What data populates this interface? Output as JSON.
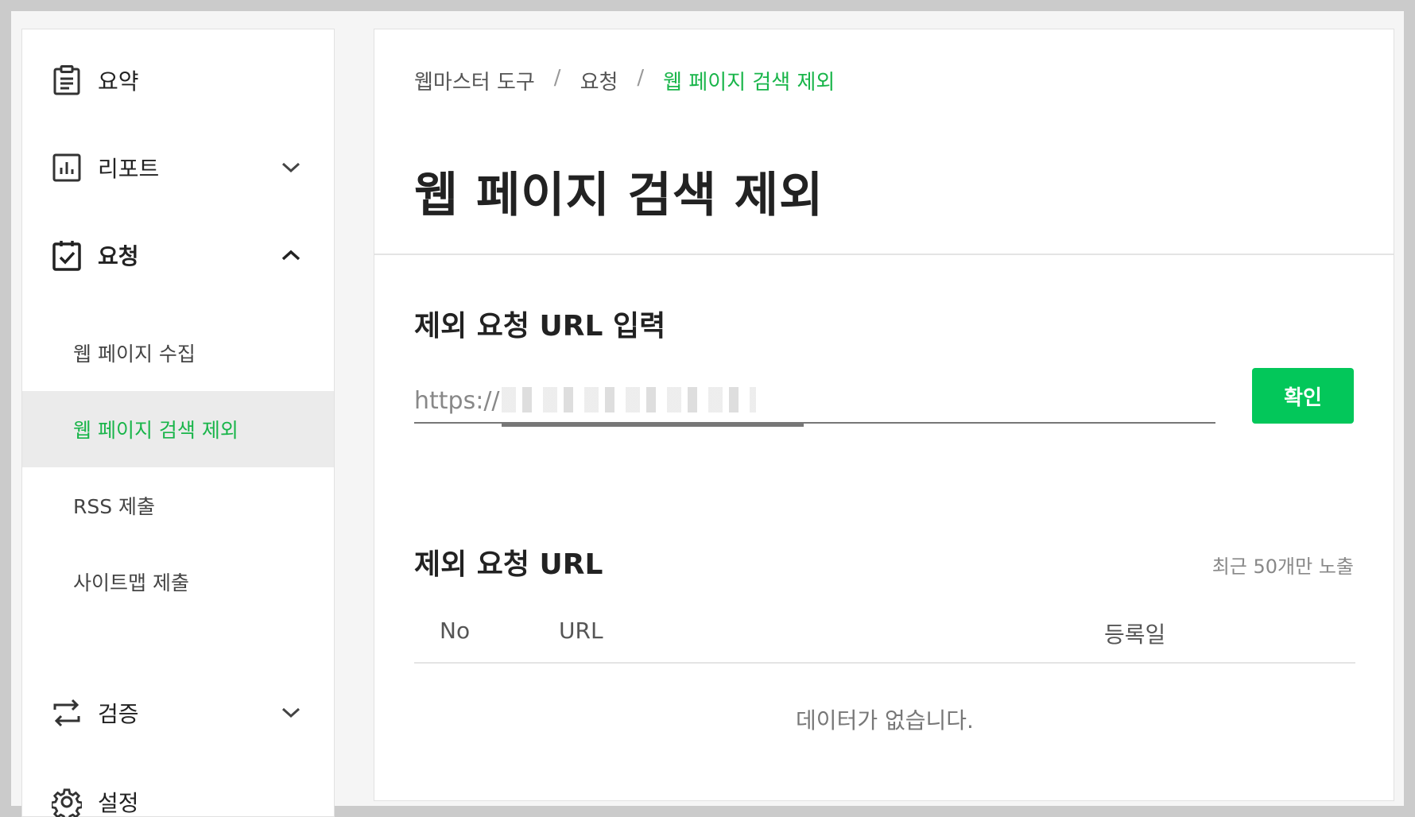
{
  "sidebar": {
    "items": [
      {
        "label": "요약",
        "icon": "clipboard-list-icon"
      },
      {
        "label": "리포트",
        "icon": "bar-chart-icon"
      },
      {
        "label": "요청",
        "icon": "clipboard-check-icon"
      },
      {
        "label": "검증",
        "icon": "repeat-arrows-icon"
      },
      {
        "label": "설정",
        "icon": "gear-icon"
      }
    ],
    "sub_items": [
      {
        "label": "웹 페이지 수집"
      },
      {
        "label": "웹 페이지 검색 제외"
      },
      {
        "label": "RSS 제출"
      },
      {
        "label": "사이트맵 제출"
      }
    ]
  },
  "breadcrumb": [
    "웹마스터 도구",
    "요청",
    "웹 페이지 검색 제외"
  ],
  "breadcrumb_sep": "/",
  "main": {
    "title": "웹 페이지 검색 제외",
    "input_section_title": "제외 요청 URL 입력",
    "url_input_value": "https://",
    "confirm_label": "확인",
    "list_section_title": "제외 요청 URL",
    "recent_note": "최근 50개만 노출",
    "table_headers": [
      "No",
      "URL",
      "등록일"
    ],
    "empty_message": "데이터가 없습니다."
  },
  "colors": {
    "accent": "#03c75a",
    "active_text": "#19b54a",
    "active_bg": "#ebebeb"
  }
}
